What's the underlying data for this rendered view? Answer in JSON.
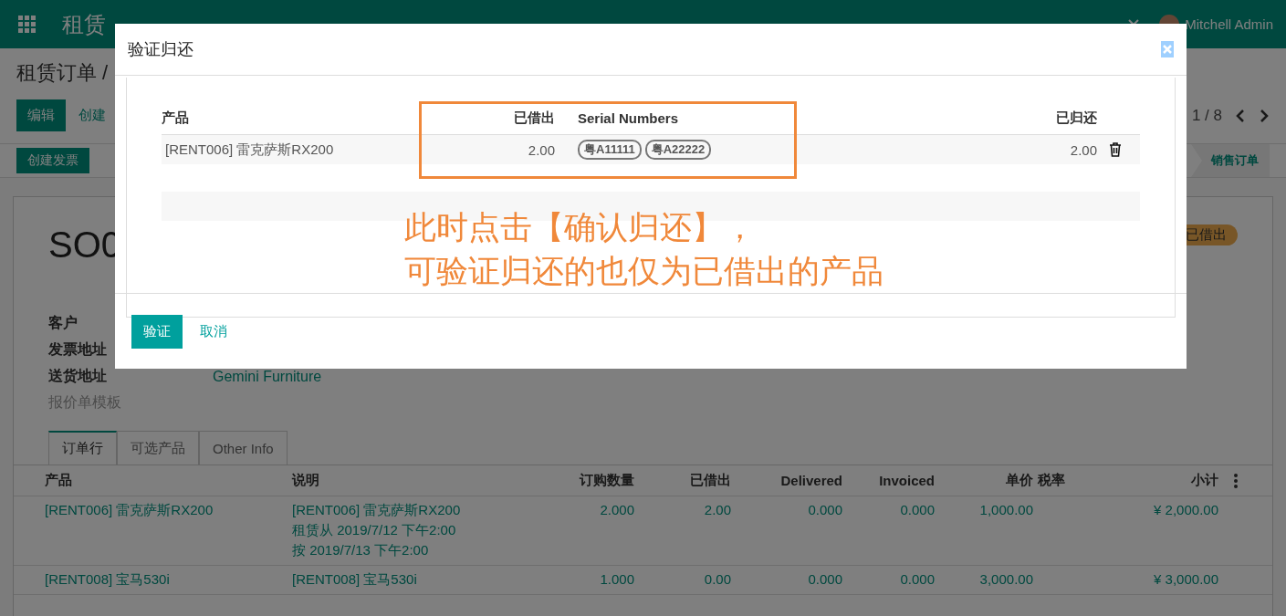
{
  "navbar": {
    "app_title": "租赁",
    "user": "Mitchell Admin"
  },
  "breadcrumb": "租赁订单 /",
  "actions": [
    {
      "label": "编辑",
      "kind": "primary"
    },
    {
      "label": "创建",
      "kind": "link"
    }
  ],
  "pager": "1 / 8",
  "toolbar_buttons": [
    "创建发票"
  ],
  "status_stage": "销售订单",
  "record": {
    "title": "SO0",
    "badge": "已借出",
    "fields": [
      {
        "label": "客户",
        "muted": false
      },
      {
        "label": "发票地址",
        "muted": false
      },
      {
        "label": "送货地址",
        "muted": false,
        "value": "Gemini Furniture"
      },
      {
        "label": "报价单模板",
        "muted": true
      }
    ]
  },
  "tabs": [
    {
      "label": "订单行",
      "selected": true
    },
    {
      "label": "可选产品",
      "selected": false
    },
    {
      "label": "Other Info",
      "selected": false
    }
  ],
  "order_lines": {
    "columns": [
      "产品",
      "说明",
      "订购数量",
      "已借出",
      "Delivered",
      "Invoiced",
      "单价",
      "税率",
      "小计"
    ],
    "rows": [
      {
        "product": "[RENT006] 雷克萨斯RX200",
        "description": [
          "[RENT006] 雷克萨斯RX200",
          "租赁从 2019/7/12 下午2:00",
          "按 2019/7/13 下午2:00"
        ],
        "quantity": "2.000",
        "borrowed": "2.00",
        "delivered": "0.000",
        "invoiced": "0.000",
        "price": "1,000.00",
        "subtotal": "¥ 2,000.00"
      },
      {
        "product": "[RENT008] 宝马530i",
        "description": [
          "[RENT008] 宝马530i"
        ],
        "quantity": "1.000",
        "borrowed": "0.00",
        "delivered": "0.000",
        "invoiced": "0.000",
        "price": "3,000.00",
        "subtotal": "¥ 3,000.00"
      }
    ]
  },
  "dialog": {
    "title": "验证归还",
    "columns": [
      "产品",
      "已借出",
      "Serial Numbers",
      "已归还"
    ],
    "rows": [
      {
        "product": "[RENT006] 雷克萨斯RX200",
        "borrowed": "2.00",
        "serials": [
          "粤A11111",
          "粤A22222"
        ],
        "returned": "2.00"
      }
    ],
    "buttons": [
      {
        "label": "验证",
        "kind": "primary"
      },
      {
        "label": "取消",
        "kind": "link"
      }
    ]
  },
  "annotation": {
    "lines": [
      "此时点击【确认归还】，",
      "可验证归还的也仅为已借出的产品"
    ]
  }
}
